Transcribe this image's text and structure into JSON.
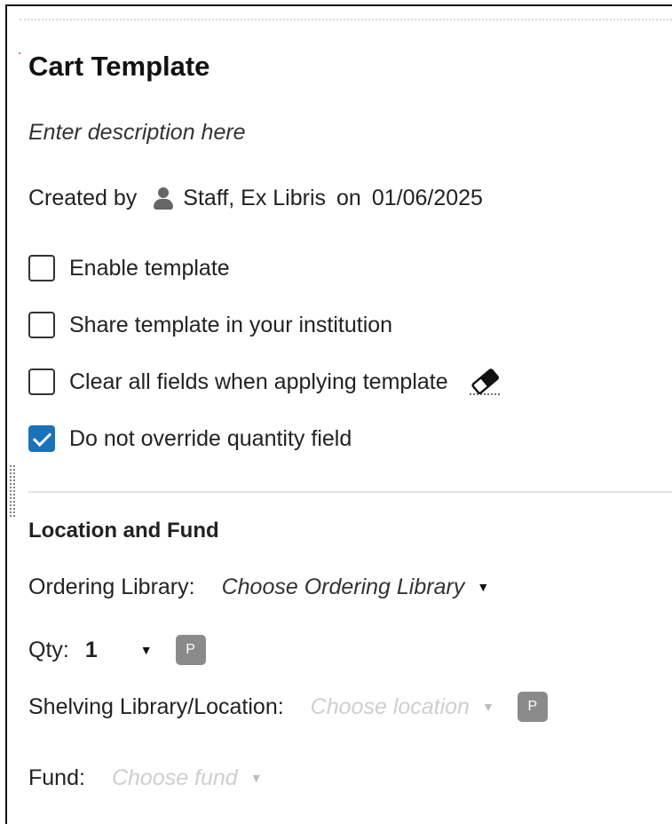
{
  "title": "Cart Template",
  "description_placeholder": "Enter description here",
  "created": {
    "prefix": "Created by",
    "user": "Staff, Ex Libris",
    "on": "on",
    "date": "01/06/2025",
    "icon": "person-icon"
  },
  "options": [
    {
      "label": "Enable template",
      "checked": false
    },
    {
      "label": "Share template in your institution",
      "checked": false
    },
    {
      "label": "Clear all fields when applying template",
      "checked": false,
      "icon": "eraser-icon"
    },
    {
      "label": "Do not override quantity field",
      "checked": true
    }
  ],
  "section_title": "Location and Fund",
  "ordering_library": {
    "label": "Ordering Library:",
    "placeholder": "Choose Ordering Library"
  },
  "qty": {
    "label": "Qty:",
    "value": "1",
    "badge": "P"
  },
  "shelving": {
    "label": "Shelving Library/Location:",
    "placeholder": "Choose location",
    "badge": "P"
  },
  "fund": {
    "label": "Fund:",
    "placeholder": "Choose fund"
  },
  "colors": {
    "checkbox_checked": "#1a73b8",
    "badge": "#8a8a8a",
    "placeholder_disabled": "#cfcfcf"
  }
}
